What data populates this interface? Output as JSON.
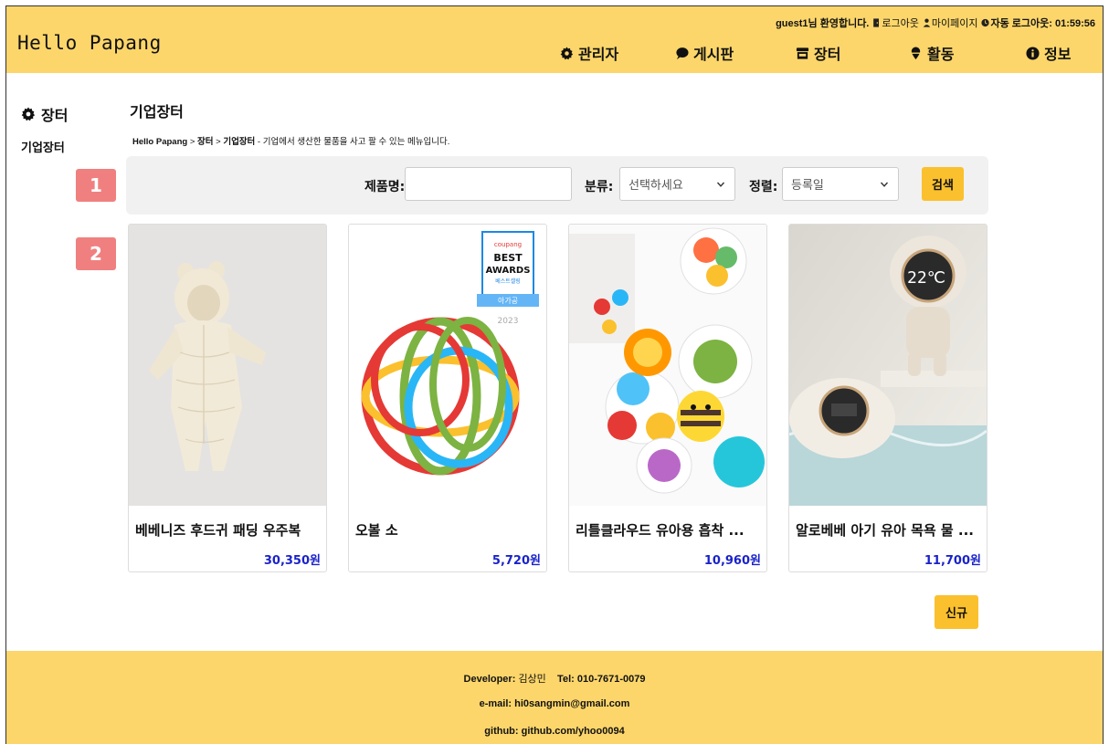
{
  "header": {
    "logo": "Hello Papang",
    "welcome": "guest1님 환영합니다.",
    "logout": "로그아웃",
    "mypage": "마이페이지",
    "auto_logout_label": "자동 로그아웃: 01:59:56",
    "nav": [
      {
        "label": "관리자",
        "icon": "gear-icon"
      },
      {
        "label": "게시판",
        "icon": "speech-bubble-icon"
      },
      {
        "label": "장터",
        "icon": "store-icon"
      },
      {
        "label": "활동",
        "icon": "location-pin-icon"
      },
      {
        "label": "정보",
        "icon": "info-icon"
      }
    ]
  },
  "sidebar": {
    "title": "장터",
    "items": [
      "기업장터"
    ]
  },
  "main": {
    "title": "기업장터",
    "breadcrumb": {
      "root": "Hello Papang",
      "sep": " > ",
      "section": "장터",
      "current": "기업장터",
      "desc": " - 기업에서 생산한 물품을 사고 팔 수 있는 메뉴입니다."
    },
    "markers": [
      "1",
      "2"
    ],
    "search": {
      "name_label": "제품명:",
      "name_value": "",
      "category_label": "분류:",
      "category_value": "선택하세요",
      "sort_label": "정렬:",
      "sort_value": "등록일",
      "button": "검색"
    },
    "products": [
      {
        "name": "베베니즈 후드귀 패딩 우주복",
        "price": "30,350원"
      },
      {
        "name": "오볼 소",
        "price": "5,720원"
      },
      {
        "name": "리틀클라우드 유아용 흡착 ...",
        "price": "10,960원"
      },
      {
        "name": "알로베베 아기 유아 목욕 물 ...",
        "price": "11,700원"
      }
    ],
    "award_badge": {
      "brand": "coupang",
      "line1": "BEST",
      "line2": "AWARDS",
      "line3": "베스트셀링",
      "line4": "아가공",
      "year": "2023"
    },
    "thermo_reading": "22℃",
    "new_button": "신규"
  },
  "footer": {
    "developer_label": "Developer:",
    "developer": "김상민",
    "tel_label": "Tel:",
    "tel": "010-7671-0079",
    "email_label": "e-mail:",
    "email": "hi0sangmin@gmail.com",
    "github_label": "github:",
    "github": "github.com/yhoo0094"
  },
  "colors": {
    "header_bg": "#fcd66a",
    "button_bg": "#fbc02d",
    "price": "#1a23c9",
    "marker": "#f08080"
  }
}
